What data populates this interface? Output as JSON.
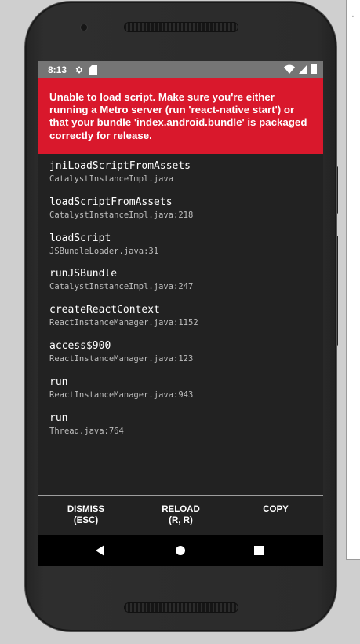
{
  "status_bar": {
    "time": "8:13",
    "left_icons": [
      "settings-gear-icon",
      "sd-card-icon"
    ],
    "right_icons": [
      "wifi-icon",
      "cellular-signal-icon",
      "battery-icon"
    ]
  },
  "error": {
    "message": "Unable to load script. Make sure you're either running a Metro server (run 'react-native start') or that your bundle 'index.android.bundle' is packaged correctly for release.",
    "background_color": "#d9182c"
  },
  "stack_trace": [
    {
      "method": "jniLoadScriptFromAssets",
      "file": "CatalystInstanceImpl.java"
    },
    {
      "method": "loadScriptFromAssets",
      "file": "CatalystInstanceImpl.java:218"
    },
    {
      "method": "loadScript",
      "file": "JSBundleLoader.java:31"
    },
    {
      "method": "runJSBundle",
      "file": "CatalystInstanceImpl.java:247"
    },
    {
      "method": "createReactContext",
      "file": "ReactInstanceManager.java:1152"
    },
    {
      "method": "access$900",
      "file": "ReactInstanceManager.java:123"
    },
    {
      "method": "run",
      "file": "ReactInstanceManager.java:943"
    },
    {
      "method": "run",
      "file": "Thread.java:764"
    }
  ],
  "actions": {
    "dismiss": {
      "line1": "DISMISS",
      "line2": "(ESC)"
    },
    "reload": {
      "line1": "RELOAD",
      "line2": "(R, R)"
    },
    "copy": {
      "line1": "COPY",
      "line2": ""
    }
  },
  "nav_bar": {
    "buttons": [
      "back-triangle-icon",
      "home-circle-icon",
      "recents-square-icon"
    ]
  },
  "side_panel": {
    "marker": "·"
  }
}
